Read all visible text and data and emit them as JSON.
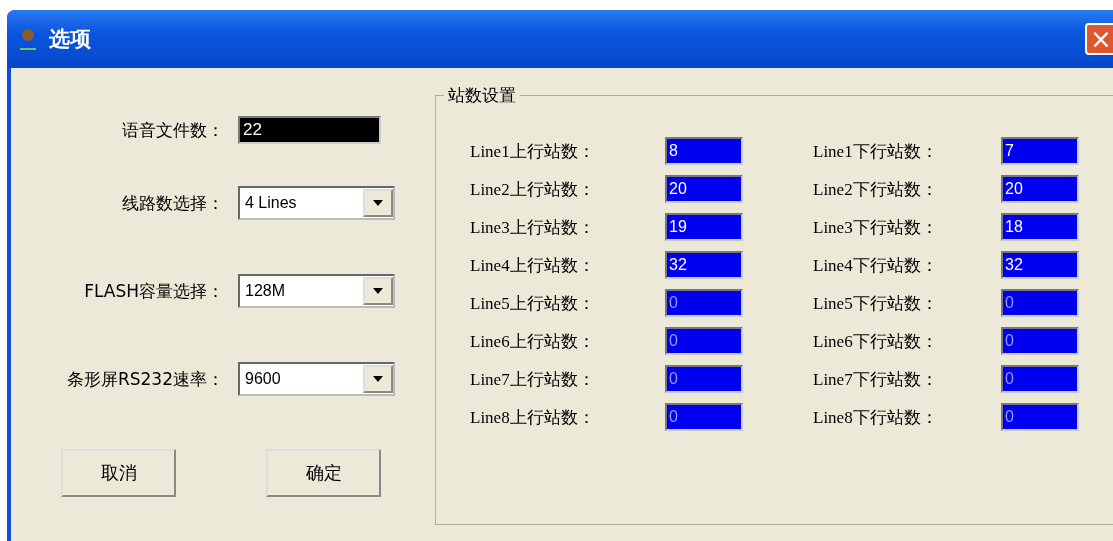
{
  "window": {
    "title": "选项",
    "close_button": "×"
  },
  "general": {
    "voice_file_count": {
      "label": "语音文件数：",
      "value": "22"
    },
    "selects": [
      {
        "label": "线路数选择：",
        "value": "4 Lines"
      },
      {
        "label": "FLASH容量选择：",
        "value": "128M"
      },
      {
        "label": "条形屏RS232速率：",
        "value": "9600"
      }
    ]
  },
  "buttons": [
    {
      "label": "取消"
    },
    {
      "label": "确定"
    }
  ],
  "station_settings": {
    "title": "站数设置",
    "rows": [
      {
        "up_label": "Line1上行站数：",
        "up_value": "8",
        "down_label": "Line1下行站数：",
        "down_value": "7",
        "disabled": false
      },
      {
        "up_label": "Line2上行站数：",
        "up_value": "20",
        "down_label": "Line2下行站数：",
        "down_value": "20",
        "disabled": false
      },
      {
        "up_label": "Line3上行站数：",
        "up_value": "19",
        "down_label": "Line3下行站数：",
        "down_value": "18",
        "disabled": false
      },
      {
        "up_label": "Line4上行站数：",
        "up_value": "32",
        "down_label": "Line4下行站数：",
        "down_value": "32",
        "disabled": false
      },
      {
        "up_label": "Line5上行站数：",
        "up_value": "0",
        "down_label": "Line5下行站数：",
        "down_value": "0",
        "disabled": true
      },
      {
        "up_label": "Line6上行站数：",
        "up_value": "0",
        "down_label": "Line6下行站数：",
        "down_value": "0",
        "disabled": true
      },
      {
        "up_label": "Line7上行站数：",
        "up_value": "0",
        "down_label": "Line7下行站数：",
        "down_value": "0",
        "disabled": true
      },
      {
        "up_label": "Line8上行站数：",
        "up_value": "0",
        "down_label": "Line8下行站数：",
        "down_value": "0",
        "disabled": true
      }
    ]
  }
}
